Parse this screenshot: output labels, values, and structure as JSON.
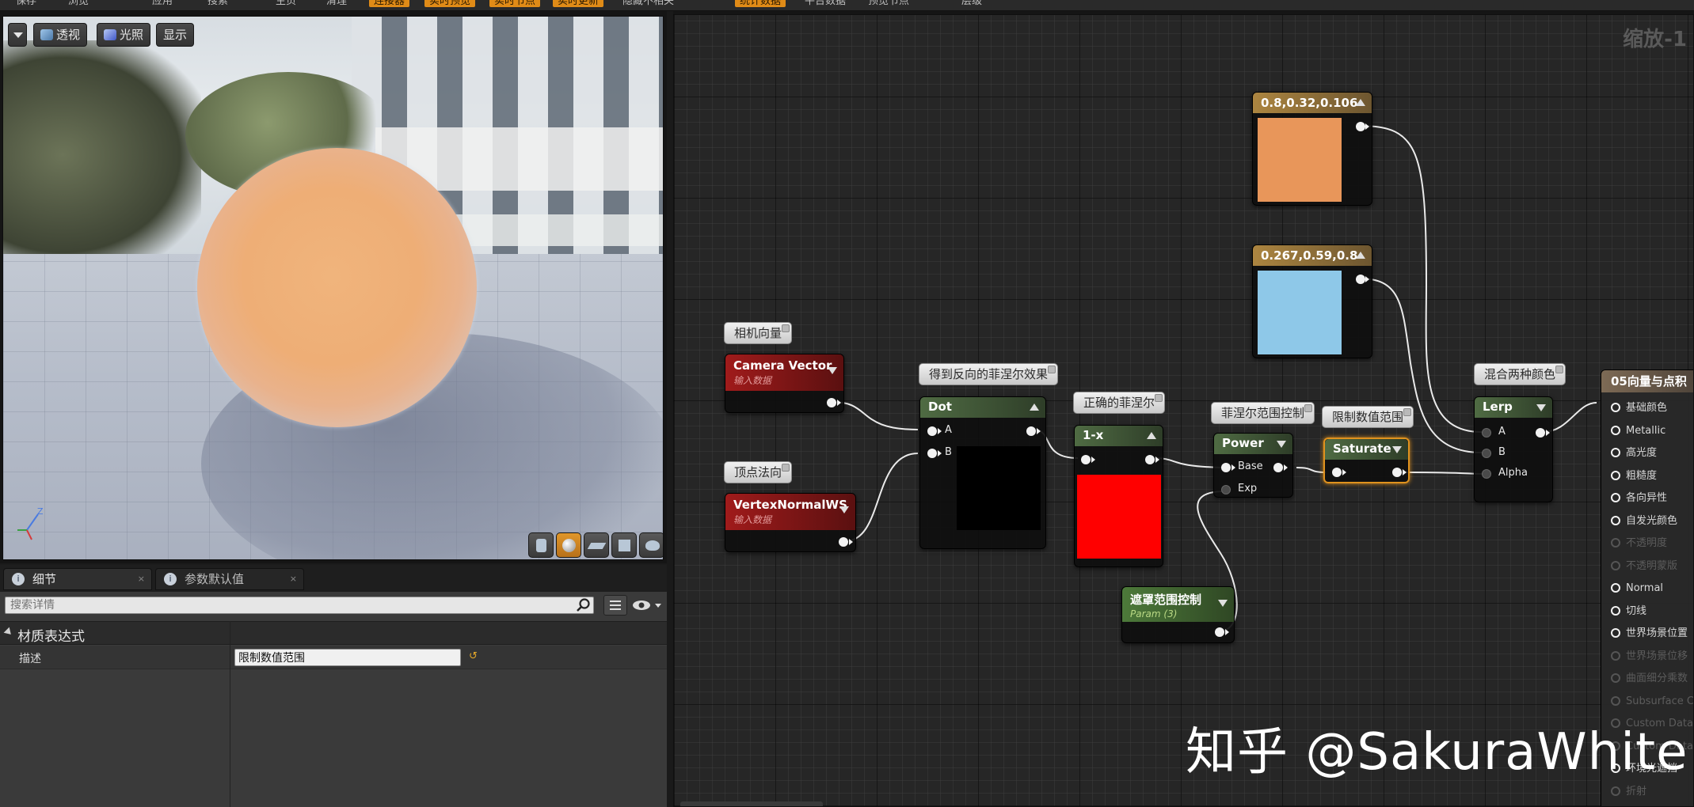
{
  "toolbar": {
    "items": [
      {
        "label": "保存",
        "highlight": false
      },
      {
        "label": "浏览",
        "highlight": false
      },
      {
        "label": "应用",
        "highlight": false
      },
      {
        "label": "搜索",
        "highlight": false
      },
      {
        "label": "主页",
        "highlight": false
      },
      {
        "label": "清理",
        "highlight": false
      },
      {
        "label": "连接器",
        "highlight": true
      },
      {
        "label": "实时预览",
        "highlight": true
      },
      {
        "label": "实时节点",
        "highlight": true
      },
      {
        "label": "实时更新",
        "highlight": true
      },
      {
        "label": "隐藏不相关",
        "highlight": false
      },
      {
        "label": "统计数据",
        "highlight": true
      },
      {
        "label": "平台数据",
        "highlight": false
      },
      {
        "label": "预览节点",
        "highlight": false
      },
      {
        "label": "层级",
        "highlight": false
      }
    ]
  },
  "viewport": {
    "buttons": {
      "perspective": "透视",
      "lit": "光照",
      "show": "显示"
    },
    "axis": {
      "x": "X",
      "y": "Y",
      "z": "Z"
    }
  },
  "details": {
    "tabs": [
      {
        "label": "细节"
      },
      {
        "label": "参数默认值"
      }
    ],
    "search_placeholder": "搜索详情",
    "category": "材质表达式",
    "property_label": "描述",
    "property_value": "限制数值范围"
  },
  "graph": {
    "zoom_label": "缩放-1",
    "comments": {
      "camera": "相机向量",
      "normal": "顶点法向",
      "dot": "得到反向的菲涅尔效果",
      "oneminus": "正确的菲涅尔",
      "power": "菲涅尔范围控制",
      "saturate": "限制数值范围",
      "lerp": "混合两种颜色"
    },
    "nodes": {
      "camera": {
        "title": "Camera Vector",
        "subtitle": "输入数据"
      },
      "normal": {
        "title": "VertexNormalWS",
        "subtitle": "输入数据"
      },
      "dot": {
        "title": "Dot",
        "pin_a": "A",
        "pin_b": "B"
      },
      "oneminus": {
        "title": "1-x"
      },
      "power": {
        "title": "Power",
        "pin_base": "Base",
        "pin_exp": "Exp"
      },
      "saturate": {
        "title": "Saturate"
      },
      "param": {
        "title": "遮罩范围控制",
        "subtitle": "Param (3)"
      },
      "lerp": {
        "title": "Lerp",
        "pin_a": "A",
        "pin_b": "B",
        "pin_alpha": "Alpha"
      },
      "color1": {
        "title": "0.8,0.32,0.106",
        "swatch": "#e8965a"
      },
      "color2": {
        "title": "0.267,0.59,0.8",
        "swatch": "#8ec8e8"
      }
    },
    "result": {
      "title": "05向量与点积",
      "pins": [
        {
          "label": "基础颜色",
          "active": true
        },
        {
          "label": "Metallic",
          "active": true
        },
        {
          "label": "高光度",
          "active": true
        },
        {
          "label": "粗糙度",
          "active": true
        },
        {
          "label": "各向异性",
          "active": true
        },
        {
          "label": "自发光颜色",
          "active": true
        },
        {
          "label": "不透明度",
          "active": false
        },
        {
          "label": "不透明蒙版",
          "active": false
        },
        {
          "label": "Normal",
          "active": true
        },
        {
          "label": "切线",
          "active": true
        },
        {
          "label": "世界场景位置",
          "active": true
        },
        {
          "label": "世界场景位移",
          "active": false
        },
        {
          "label": "曲面细分乘数",
          "active": false
        },
        {
          "label": "Subsurface C",
          "active": false
        },
        {
          "label": "Custom Data",
          "active": false
        },
        {
          "label": "Custom Data",
          "active": false
        },
        {
          "label": "环境光遮挡",
          "active": true
        },
        {
          "label": "折射",
          "active": false
        }
      ]
    },
    "watermark": "知乎 @SakuraWhite"
  },
  "colors": {
    "accent_orange": "#e08b17",
    "dot_preview": "#000000",
    "oneminus_preview": "#ff0000"
  }
}
